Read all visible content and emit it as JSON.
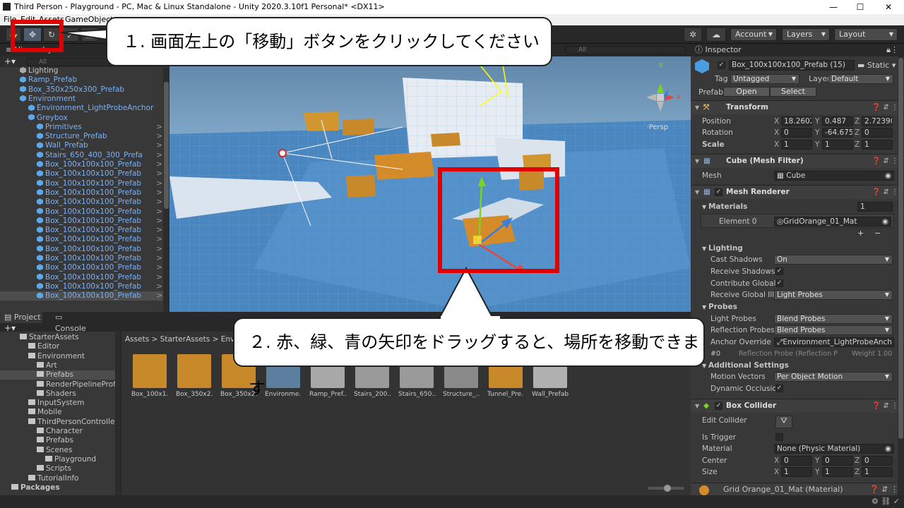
{
  "window": {
    "title": "Third Person - Playground - PC, Mac & Linux Standalone - Unity 2020.3.10f1 Personal* <DX11>",
    "minimize": "—",
    "maximize": "☐",
    "close": "✕"
  },
  "menu": [
    "File",
    "Edit",
    "Assets",
    "GameObject"
  ],
  "toolbar": {
    "account": "Account",
    "layers": "Layers",
    "layout": "Layout"
  },
  "hierarchy": {
    "search_placeholder": "All",
    "items": [
      {
        "label": "Lighting",
        "indent": 1,
        "blue": false
      },
      {
        "label": "Ramp_Prefab",
        "indent": 1,
        "blue": true
      },
      {
        "label": "Box_350x250x300_Prefab",
        "indent": 1,
        "blue": true
      },
      {
        "label": "Environment",
        "indent": 1,
        "blue": true
      },
      {
        "label": "Environment_LightProbeAnchor",
        "indent": 2,
        "blue": true
      },
      {
        "label": "Greybox",
        "indent": 2,
        "blue": true
      },
      {
        "label": "Primitives",
        "indent": 3,
        "blue": true
      },
      {
        "label": "Structure_Prefab",
        "indent": 3,
        "blue": true
      },
      {
        "label": "Wall_Prefab",
        "indent": 3,
        "blue": true
      },
      {
        "label": "Stairs_650_400_300_Prefa",
        "indent": 3,
        "blue": true
      },
      {
        "label": "Box_100x100x100_Prefab",
        "indent": 3,
        "blue": true
      },
      {
        "label": "Box_100x100x100_Prefab",
        "indent": 3,
        "blue": true
      },
      {
        "label": "Box_100x100x100_Prefab",
        "indent": 3,
        "blue": true
      },
      {
        "label": "Box_100x100x100_Prefab",
        "indent": 3,
        "blue": true
      },
      {
        "label": "Box_100x100x100_Prefab",
        "indent": 3,
        "blue": true
      },
      {
        "label": "Box_100x100x100_Prefab",
        "indent": 3,
        "blue": true
      },
      {
        "label": "Box_100x100x100_Prefab",
        "indent": 3,
        "blue": true
      },
      {
        "label": "Box_100x100x100_Prefab",
        "indent": 3,
        "blue": true
      },
      {
        "label": "Box_100x100x100_Prefab",
        "indent": 3,
        "blue": true
      },
      {
        "label": "Box_100x100x100_Prefab",
        "indent": 3,
        "blue": true
      },
      {
        "label": "Box_100x100x100_Prefab",
        "indent": 3,
        "blue": true
      },
      {
        "label": "Box_100x100x100_Prefab",
        "indent": 3,
        "blue": true
      },
      {
        "label": "Box_100x100x100_Prefab",
        "indent": 3,
        "blue": true
      },
      {
        "label": "Box_100x100x100_Prefab",
        "indent": 3,
        "blue": true
      },
      {
        "label": "Box_100x100x100_Prefab",
        "indent": 3,
        "blue": true
      }
    ]
  },
  "scene": {
    "search_placeholder": "All",
    "persp": "Persp",
    "gizmo_y": "y",
    "gizmo_x": "x"
  },
  "bottom_tabs": {
    "project": "Project",
    "console": "Console"
  },
  "project": {
    "folders": [
      {
        "label": "StarterAssets",
        "indent": 1
      },
      {
        "label": "Editor",
        "indent": 2
      },
      {
        "label": "Environment",
        "indent": 2
      },
      {
        "label": "Art",
        "indent": 3
      },
      {
        "label": "Prefabs",
        "indent": 3
      },
      {
        "label": "RenderPipelineProfil",
        "indent": 3
      },
      {
        "label": "Shaders",
        "indent": 3
      },
      {
        "label": "InputSystem",
        "indent": 2
      },
      {
        "label": "Mobile",
        "indent": 2
      },
      {
        "label": "ThirdPersonController",
        "indent": 2
      },
      {
        "label": "Character",
        "indent": 3
      },
      {
        "label": "Prefabs",
        "indent": 3
      },
      {
        "label": "Scenes",
        "indent": 3
      },
      {
        "label": "Playground",
        "indent": 4
      },
      {
        "label": "Scripts",
        "indent": 3
      },
      {
        "label": "TutorialInfo",
        "indent": 2
      },
      {
        "label": "Packages",
        "indent": 0
      }
    ],
    "breadcrumb": [
      "Assets",
      "StarterAssets",
      "Envir"
    ],
    "assets": [
      {
        "label": "Box_100x1...",
        "color": "#c8892a"
      },
      {
        "label": "Box_350x2...",
        "color": "#c8892a"
      },
      {
        "label": "Box_350x2...",
        "color": "#c8892a"
      },
      {
        "label": "Environme...",
        "color": "#5c7fa0"
      },
      {
        "label": "Ramp_Pref...",
        "color": "#a8a8a8"
      },
      {
        "label": "Stairs_200...",
        "color": "#9a9a9a"
      },
      {
        "label": "Stairs_650...",
        "color": "#9a9a9a"
      },
      {
        "label": "Structure_...",
        "color": "#8a8a8a"
      },
      {
        "label": "Tunnel_Pre...",
        "color": "#c8892a"
      },
      {
        "label": "Wall_Prefab",
        "color": "#b0b0b0"
      }
    ]
  },
  "inspector": {
    "tab": "Inspector",
    "object_name": "Box_100x100x100_Prefab (15)",
    "static": "Static",
    "tag_label": "Tag",
    "tag_value": "Untagged",
    "layer_label": "Layer",
    "layer_value": "Default",
    "prefab_label": "Prefab",
    "open": "Open",
    "select": "Select",
    "transform": {
      "title": "Transform",
      "position_label": "Position",
      "position": {
        "x": "18.2602",
        "y": "0.487",
        "z": "2.72390"
      },
      "rotation_label": "Rotation",
      "rotation": {
        "x": "0",
        "y": "-64.675",
        "z": "0"
      },
      "scale_label": "Scale",
      "scale": {
        "x": "1",
        "y": "1",
        "z": "1"
      }
    },
    "mesh_filter": {
      "title": "Cube (Mesh Filter)",
      "mesh_label": "Mesh",
      "mesh": "Cube"
    },
    "mesh_renderer": {
      "title": "Mesh Renderer",
      "materials_label": "Materials",
      "materials_count": "1",
      "element0_label": "Element 0",
      "element0": "GridOrange_01_Mat",
      "plus": "+",
      "minus": "−",
      "lighting_label": "Lighting",
      "cast_shadows_label": "Cast Shadows",
      "cast_shadows": "On",
      "receive_shadows_label": "Receive Shadows",
      "contribute_gi_label": "Contribute Global I",
      "receive_gi_label": "Receive Global Illu",
      "receive_gi": "Light Probes",
      "probes_label": "Probes",
      "light_probes_label": "Light Probes",
      "light_probes": "Blend Probes",
      "reflection_probes_label": "Reflection Probes",
      "reflection_probes": "Blend Probes",
      "anchor_override_label": "Anchor Override",
      "anchor_override": "Environment_LightProbeAnch",
      "probe_index": "#0",
      "probe_name": "Reflection Probe (Reflection P",
      "probe_weight": "Weight 1.00",
      "additional_label": "Additional Settings",
      "motion_vectors_label": "Motion Vectors",
      "motion_vectors": "Per Object Motion",
      "dynamic_occlusion_label": "Dynamic Occlusion"
    },
    "box_collider": {
      "title": "Box Collider",
      "edit_collider_label": "Edit Collider",
      "is_trigger_label": "Is Trigger",
      "material_label": "Material",
      "material": "None (Physic Material)",
      "center_label": "Center",
      "center": {
        "x": "0",
        "y": "0",
        "z": "0"
      },
      "size_label": "Size",
      "size": {
        "x": "1",
        "y": "1",
        "z": "1"
      }
    },
    "material_footer": "Grid Orange_01_Mat (Material)"
  },
  "callouts": {
    "step1": "１. 画面左上の「移動」ボタンをクリックしてください",
    "step2": "２. 赤、緑、青の矢印をドラッグすると、場所を移動できます"
  },
  "colors": {
    "highlight_red": "#e00000",
    "orange_box": "#d48c2a",
    "axis_x": "#e8453c",
    "axis_y": "#7ed321",
    "axis_z": "#3b7ddd"
  }
}
